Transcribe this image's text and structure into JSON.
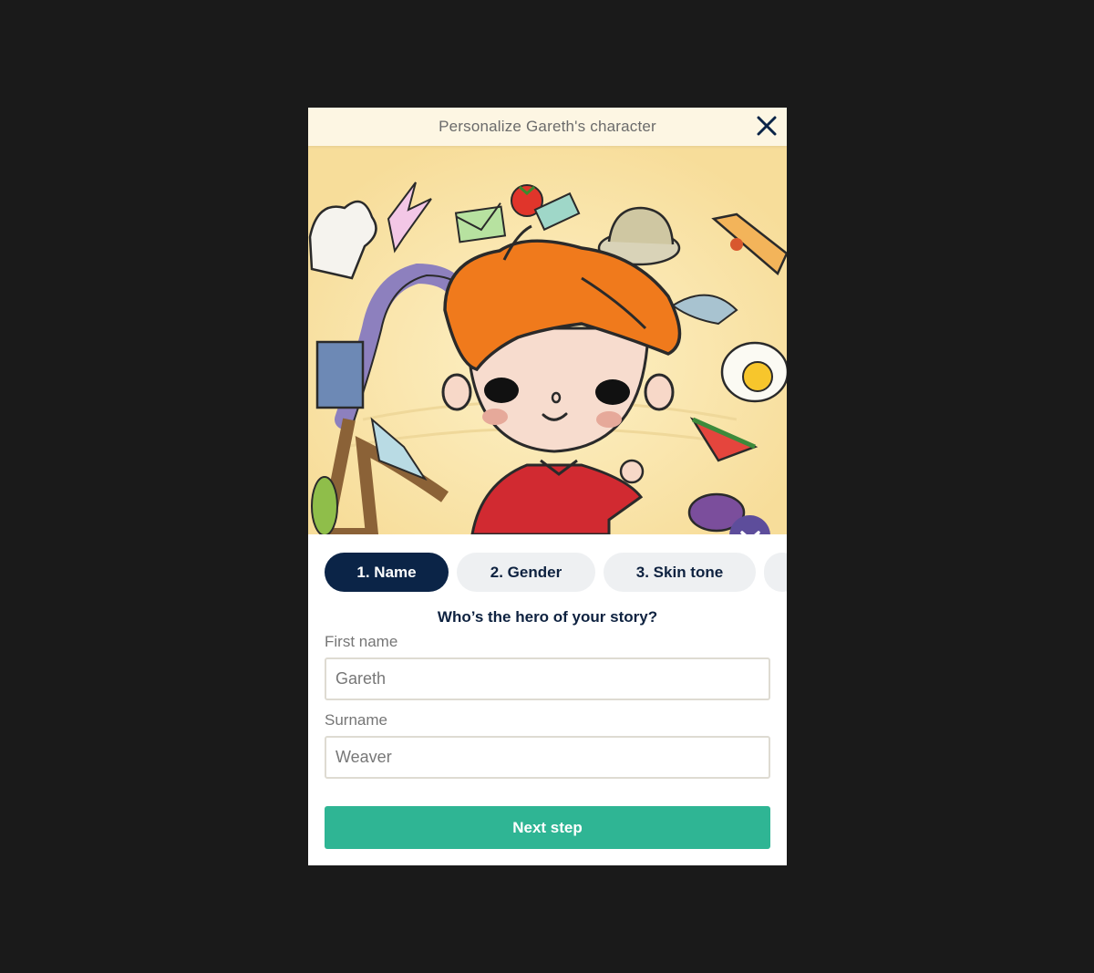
{
  "modal": {
    "title": "Personalize Gareth's character"
  },
  "icons": {
    "close": "close-icon",
    "collapse": "chevron-down-icon"
  },
  "tabs": [
    {
      "label": "1. Name",
      "active": true
    },
    {
      "label": "2. Gender",
      "active": false
    },
    {
      "label": "3. Skin tone",
      "active": false
    }
  ],
  "form": {
    "question": "Who’s the hero of your story?",
    "first_name": {
      "label": "First name",
      "value": "Gareth"
    },
    "surname": {
      "label": "Surname",
      "value": "Weaver"
    },
    "submit_label": "Next step"
  },
  "colors": {
    "backdrop": "#1a1a1a",
    "header_bg": "#fdf6e3",
    "navy": "#0b2447",
    "tab_inactive": "#eef0f2",
    "accent_green": "#2fb594",
    "collapse_purple": "#5d4d9b"
  }
}
